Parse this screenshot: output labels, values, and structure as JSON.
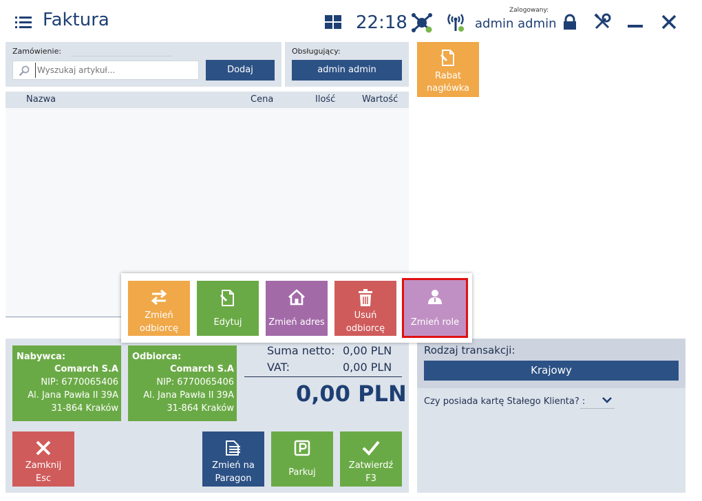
{
  "header": {
    "title": "Faktura",
    "clock": "22:18",
    "logged_label": "Zalogowany:",
    "logged_user": "admin admin"
  },
  "order": {
    "label": "Zamówienie:",
    "search_placeholder": "Wyszukaj artykuł...",
    "add_button": "Dodaj"
  },
  "served": {
    "label": "Obsługujący:",
    "user_button": "admin admin"
  },
  "rabat_tile": {
    "line1": "Rabat",
    "line2": "nagłówka"
  },
  "table": {
    "columns": [
      "Nazwa",
      "Cena",
      "Ilość",
      "Wartość"
    ]
  },
  "popup": {
    "buttons": [
      {
        "line1": "Zmień",
        "line2": "odbiorcę",
        "icon": "swap-arrows-icon",
        "color": "#f0a848"
      },
      {
        "line1": "Edytuj",
        "line2": "",
        "icon": "edit-document-icon",
        "color": "#6aaa46"
      },
      {
        "line1": "Zmień adres",
        "line2": "",
        "icon": "home-icon",
        "color": "#a36aa8"
      },
      {
        "line1": "Usuń",
        "line2": "odbiorcę",
        "icon": "trash-icon",
        "color": "#d05b5b"
      },
      {
        "line1": "Zmień role",
        "line2": "",
        "icon": "person-icon",
        "color": "#c090c4"
      }
    ]
  },
  "buyer": {
    "title": "Nabywca:",
    "name": "Comarch S.A",
    "nip": "NIP: 6770065406",
    "street": "Al. Jana Pawła II 39A",
    "city": "31-864  Kraków"
  },
  "recipient": {
    "title": "Odbiorca:",
    "name": "Comarch S.A",
    "nip": "NIP: 6770065406",
    "street": "Al. Jana Pawła II 39A",
    "city": "31-864  Kraków"
  },
  "summary": {
    "net_label": "Suma netto:",
    "net_value": "0,00 PLN",
    "vat_label": "VAT:",
    "vat_value": "0,00 PLN",
    "total": "0,00 PLN"
  },
  "actions": {
    "close_line1": "Zamknij",
    "close_line2": "Esc",
    "receipt_line1": "Zmień na",
    "receipt_line2": "Paragon",
    "park": "Parkuj",
    "confirm_line1": "Zatwierdź",
    "confirm_line2": "F3"
  },
  "transaction": {
    "label": "Rodzaj transakcji:",
    "value": "Krajowy",
    "loyalty_label": "Czy posiada kartę Stałego Klienta? :"
  },
  "colors": {
    "navy": "#1e3f73",
    "panel": "#dde3eb",
    "green": "#6aaa46",
    "orange": "#f0a848",
    "red": "#d05b5b",
    "purple": "#a36aa8",
    "blue_button": "#2c5185"
  }
}
